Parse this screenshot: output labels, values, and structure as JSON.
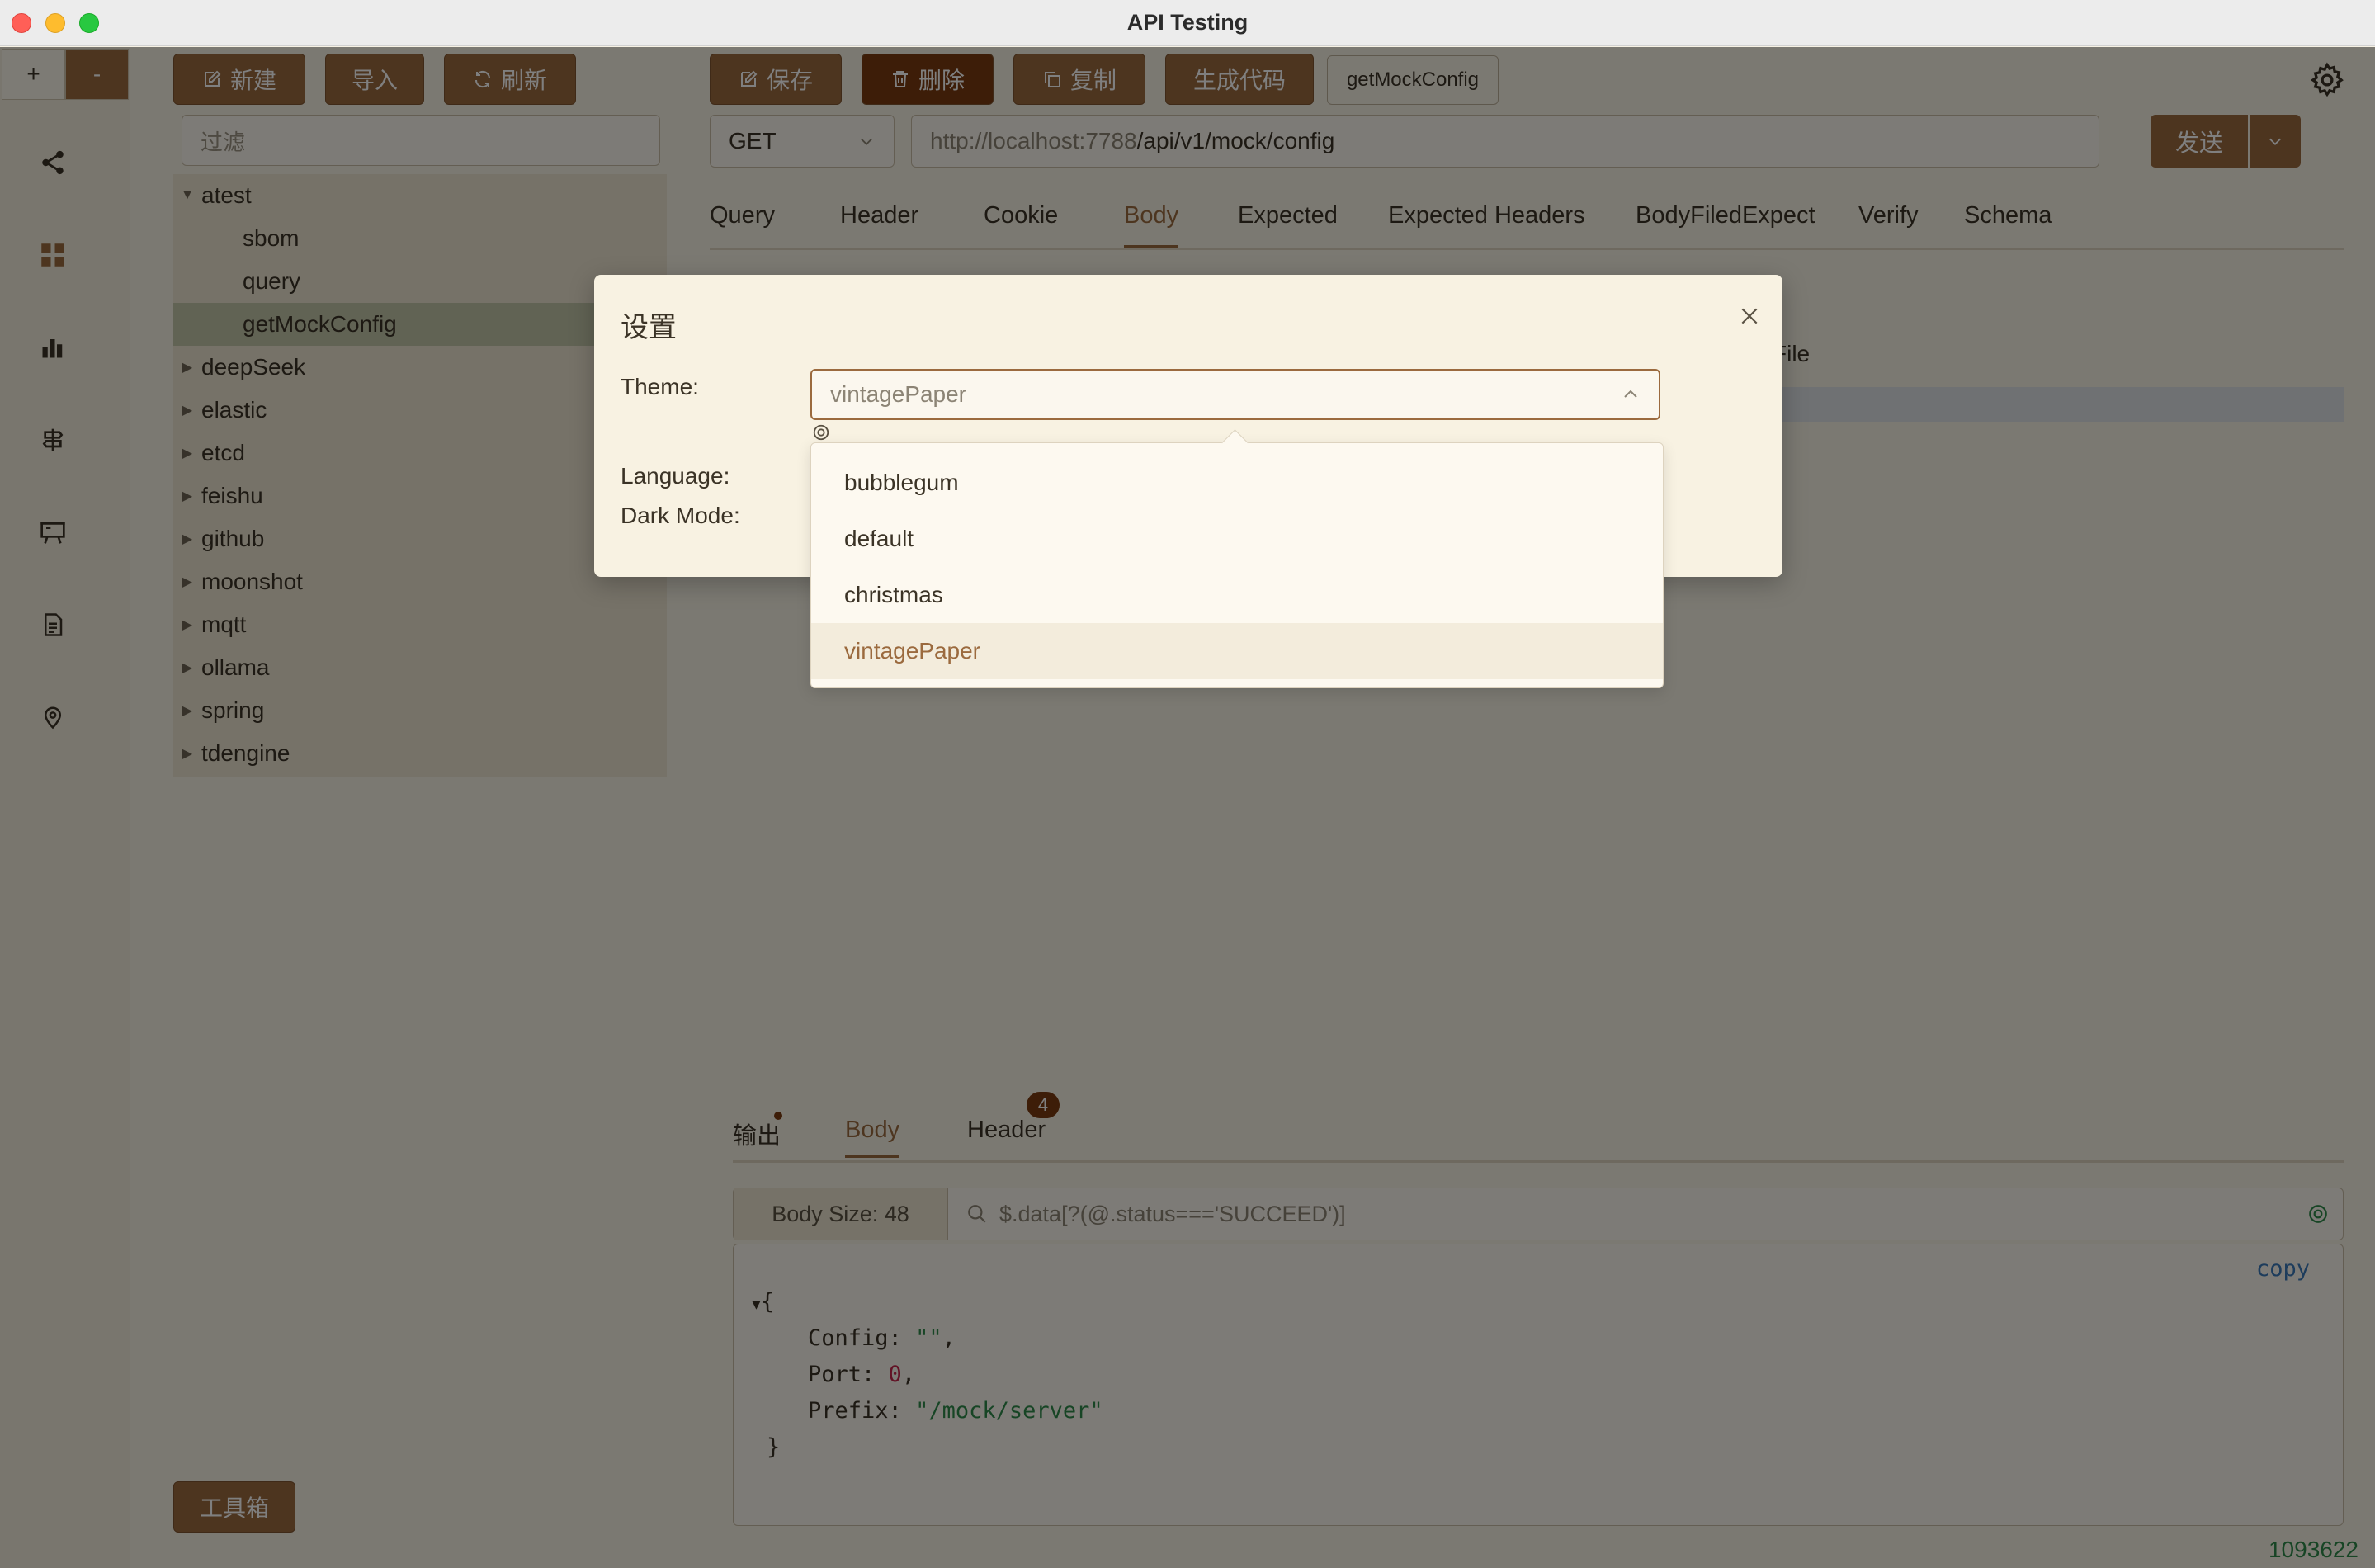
{
  "window": {
    "title": "API Testing"
  },
  "rail": {
    "plus": "+",
    "minus": "-"
  },
  "toolbar": {
    "new": "新建",
    "import": "导入",
    "refresh": "刷新",
    "save": "保存",
    "delete": "删除",
    "copy": "复制",
    "gen_code": "生成代码",
    "case_name": "getMockConfig"
  },
  "filter": {
    "placeholder": "过滤"
  },
  "tree": {
    "items": [
      {
        "label": "atest",
        "expanded": true
      },
      {
        "label": "sbom"
      },
      {
        "label": "query"
      },
      {
        "label": "getMockConfig",
        "selected": true
      },
      {
        "label": "deepSeek"
      },
      {
        "label": "elastic"
      },
      {
        "label": "etcd"
      },
      {
        "label": "feishu"
      },
      {
        "label": "github"
      },
      {
        "label": "moonshot"
      },
      {
        "label": "mqtt"
      },
      {
        "label": "ollama"
      },
      {
        "label": "spring"
      },
      {
        "label": "tdengine"
      }
    ]
  },
  "toolbox": {
    "label": "工具箱"
  },
  "request": {
    "method": "GET",
    "url_host": "http://localhost:7788",
    "url_path": "/api/v1/mock/config",
    "send": "发送"
  },
  "tabs": [
    "Query",
    "Header",
    "Cookie",
    "Body",
    "Expected",
    "Expected Headers",
    "BodyFiledExpect",
    "Verify",
    "Schema"
  ],
  "body_hint": "File",
  "response": {
    "tabs": {
      "output": "输出",
      "body": "Body",
      "header": "Header",
      "header_count": "4"
    },
    "body_size": "Body Size: 48",
    "jsonpath": "$.data[?(@.status==='SUCCEED')]",
    "copy": "copy",
    "json": {
      "open": "{",
      "config_key": "Config:",
      "config_val": "\"\"",
      "port_key": "Port:",
      "port_val": "0",
      "prefix_key": "Prefix:",
      "prefix_val": "\"/mock/server\"",
      "close": "}"
    },
    "footer_number": "1093622"
  },
  "dialog": {
    "title": "设置",
    "theme_label": "Theme:",
    "language_label": "Language:",
    "darkmode_label": "Dark Mode:",
    "theme_value": "vintagePaper",
    "options": [
      "bubblegum",
      "default",
      "christmas",
      "vintagePaper"
    ],
    "selected_option": "vintagePaper"
  },
  "colors": {
    "accent": "#9b6a3e",
    "danger": "#7a3b10",
    "background": "#f7f2e4"
  }
}
